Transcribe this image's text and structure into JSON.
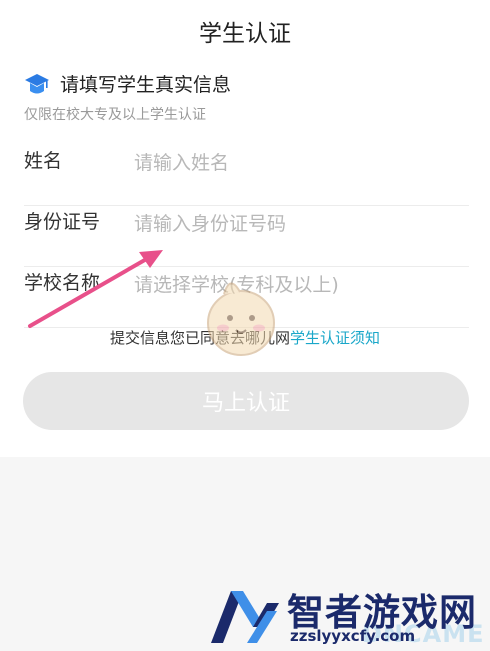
{
  "page": {
    "title": "学生认证"
  },
  "intro": {
    "heading": "请填写学生真实信息",
    "subtext": "仅限在校大专及以上学生认证"
  },
  "form": {
    "fields": [
      {
        "label": "姓名",
        "placeholder": "请输入姓名",
        "value": ""
      },
      {
        "label": "身份证号",
        "placeholder": "请输入身份证号码",
        "value": ""
      },
      {
        "label": "学校名称",
        "placeholder": "请选择学校(专科及以上)",
        "value": ""
      }
    ]
  },
  "agreement": {
    "text": "提交信息您已同意去哪儿网",
    "link": "学生认证须知"
  },
  "submit": {
    "label": "马上认证"
  },
  "watermark": {
    "title": "智者游戏网",
    "url": "zzslyyxcfy.com",
    "ghost": "DNCAME"
  },
  "colors": {
    "accent_link": "#1aa7c9",
    "arrow": "#e8508a",
    "button_disabled": "#e6e6e6",
    "page_bg": "#f6f6f6"
  }
}
